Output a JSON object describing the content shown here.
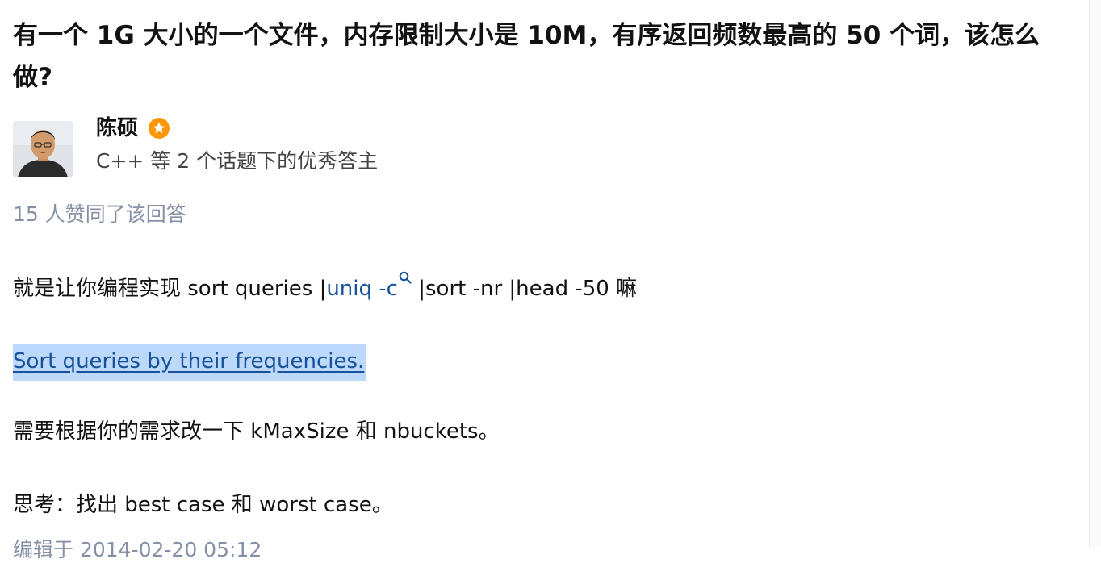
{
  "question": {
    "title": "有一个 1G 大小的一个文件，内存限制大小是 10M，有序返回频数最高的 50 个词，该怎么做?"
  },
  "author": {
    "name": "陈硕",
    "badge_icon": "excellent-answerer-badge-icon",
    "headline": "C++ 等 2 个话题下的优秀答主"
  },
  "answer": {
    "vote_text": "15 人赞同了该回答",
    "para1_prefix": "就是让你编程实现 sort queries |",
    "search_term": "uniq -c",
    "para1_suffix": " |sort -nr |head -50 嘛",
    "link_text": "Sort queries by their frequencies.",
    "para3": "需要根据你的需求改一下 kMaxSize 和 nbuckets。",
    "para4": "思考：找出 best case 和 worst case。",
    "edited_text": "编辑于 2014-02-20 05:12"
  },
  "colors": {
    "link": "#175199",
    "meta": "#8590a6",
    "selection": "#bcd8fa",
    "badge": "#ff9607"
  }
}
